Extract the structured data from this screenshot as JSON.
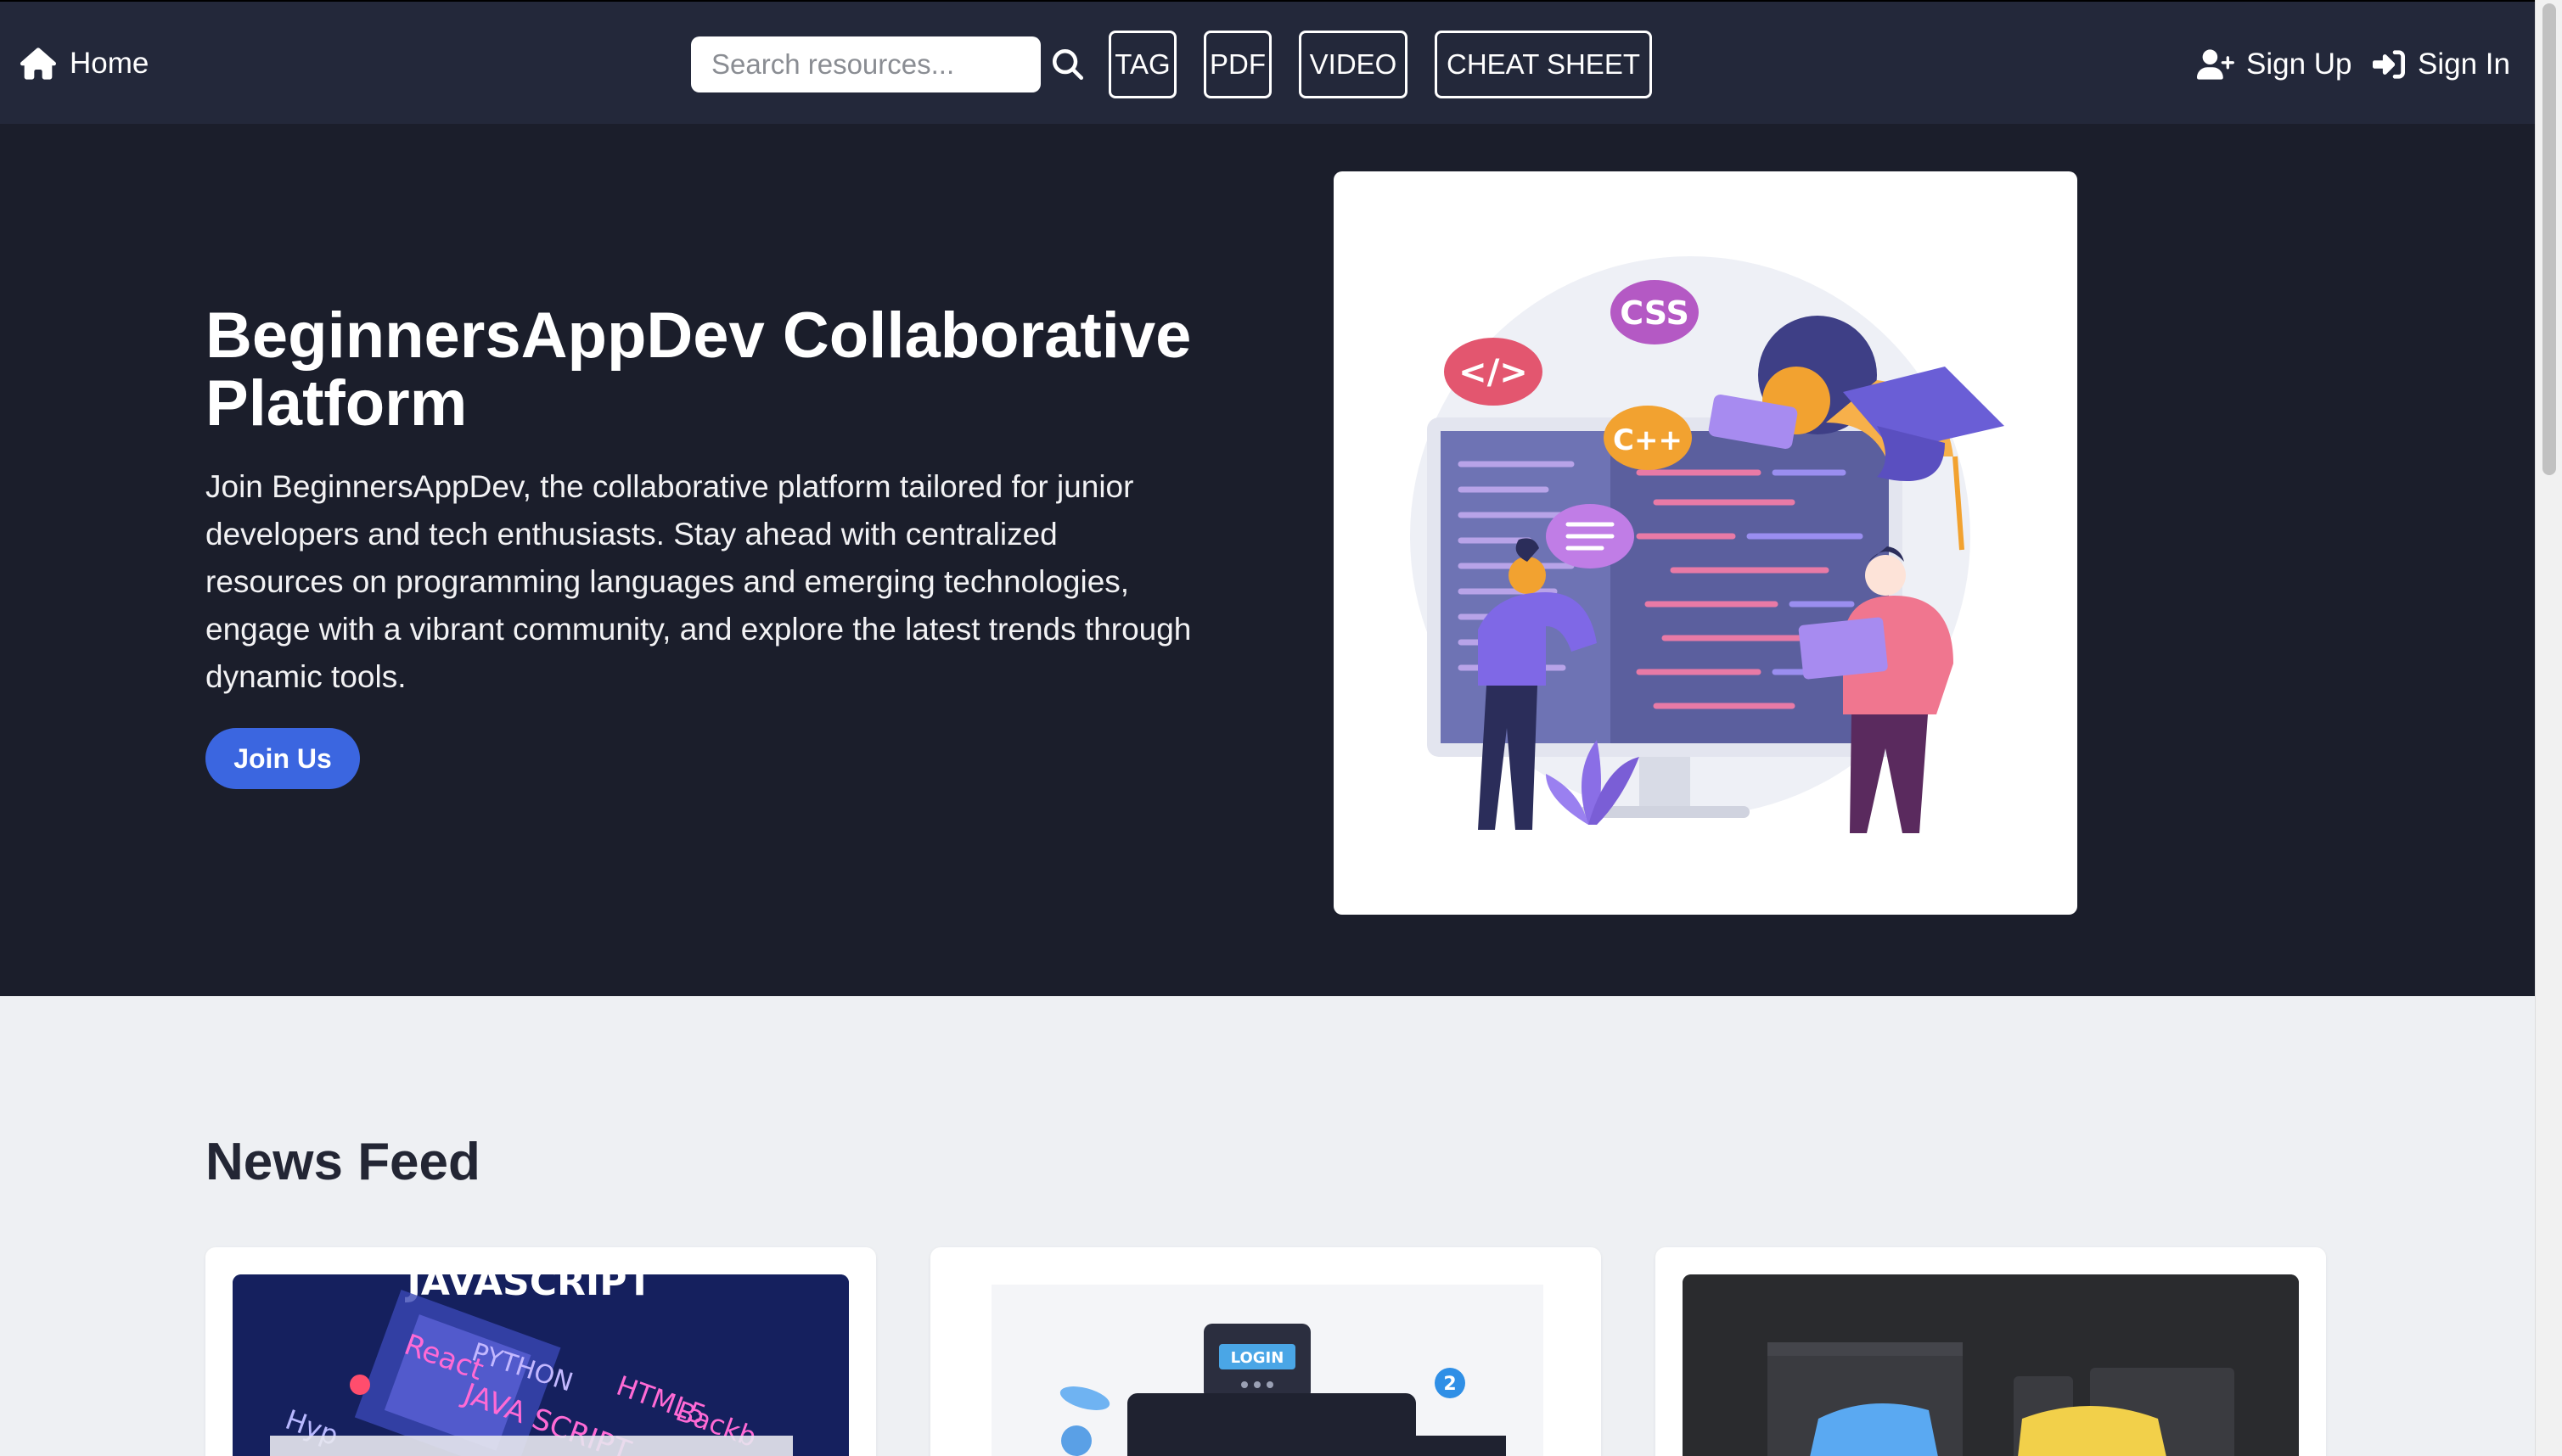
{
  "nav": {
    "home_label": "Home",
    "search_placeholder": "Search resources...",
    "tags": [
      "TAG",
      "PDF",
      "VIDEO",
      "CHEAT SHEET"
    ],
    "sign_up_label": "Sign Up",
    "sign_in_label": "Sign In",
    "icons": {
      "home": "home-icon",
      "search": "search-icon",
      "sign_up": "user-plus-icon",
      "sign_in": "sign-in-icon"
    }
  },
  "hero": {
    "title": "BeginnersAppDev Collaborative Platform",
    "description": "Join BeginnersAppDev, the collaborative platform tailored for junior developers and tech enthusiasts. Stay ahead with centralized resources on programming languages and emerging technologies, engage with a vibrant community, and explore the latest trends through dynamic tools.",
    "cta_label": "Join Us",
    "illustration_bubbles": [
      "CSS",
      "</>",
      "C++"
    ]
  },
  "news": {
    "title": "News Feed",
    "cards": [
      {
        "thumb_words": [
          "JAVASCRIPT",
          "PYTHON",
          "React",
          "JAVA SCRIPT",
          "HTML5",
          "Backb",
          "Hyp"
        ]
      },
      {
        "thumb_words": [
          "LOGIN",
          "2"
        ]
      },
      {
        "thumb_words": []
      }
    ]
  },
  "colors": {
    "nav_bg": "#23283a",
    "hero_bg": "#1b1e2b",
    "accent": "#3b66e0",
    "news_bg": "#eef0f3"
  }
}
